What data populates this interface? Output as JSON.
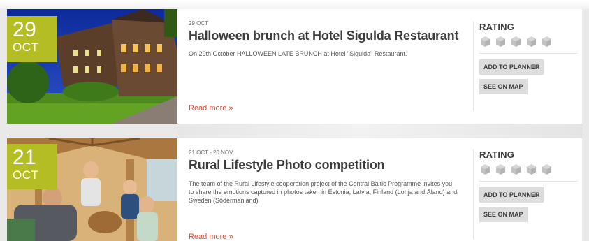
{
  "events": [
    {
      "day": "29",
      "month": "OCT",
      "date_range": "29 OCT",
      "title": "Halloween brunch at Hotel Sigulda Restaurant",
      "description": "On 29th October HALLOWEEN LATE BRUNCH at Hotel \"Sigulda\" Restaurant.",
      "read_more": "Read more »",
      "rating_label": "RATING",
      "rating_value": 0,
      "rating_max": 5,
      "add_to_planner": "ADD TO PLANNER",
      "see_on_map": "SEE ON MAP"
    },
    {
      "day": "21",
      "month": "OCT",
      "date_range": "21 OCT - 20 NOV",
      "title": "Rural Lifestyle Photo competition",
      "description": "The team of the Rural Lifestyle cooperation project of the Central Baltic Programme invites you to share the emotions captured in photos taken in Estonia, Latvia, Finland (Lohja and Åland) and Sweden (Södermanland)",
      "read_more": "Read more »",
      "rating_label": "RATING",
      "rating_value": 0,
      "rating_max": 5,
      "add_to_planner": "ADD TO PLANNER",
      "see_on_map": "SEE ON MAP"
    }
  ],
  "icons": {
    "rating": "rating-cube-icon"
  },
  "colors": {
    "badge": "#b5bd25",
    "read_more": "#e2492f",
    "button_bg": "#dddddd"
  }
}
